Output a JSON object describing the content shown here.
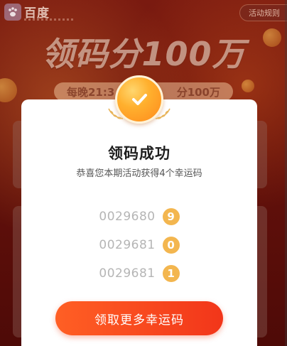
{
  "background": {
    "logo_text": "百度",
    "rules_label": "活动规则",
    "banner_title": "领码分100万",
    "pill_left": "每晚21:3",
    "pill_right": "分100万"
  },
  "modal": {
    "title": "领码成功",
    "subtitle": "恭喜您本期活动获得4个幸运码",
    "codes": [
      {
        "number": "0029680",
        "digit": "9"
      },
      {
        "number": "0029681",
        "digit": "0"
      },
      {
        "number": "0029681",
        "digit": "1"
      }
    ],
    "cta_label": "领取更多幸运码"
  },
  "colors": {
    "accent": "#f2361a",
    "badge": "#f3b64f",
    "medal": "#ffb02e"
  },
  "icons": {
    "medal": "check-medal-icon",
    "logo": "baidu-paw-icon"
  }
}
